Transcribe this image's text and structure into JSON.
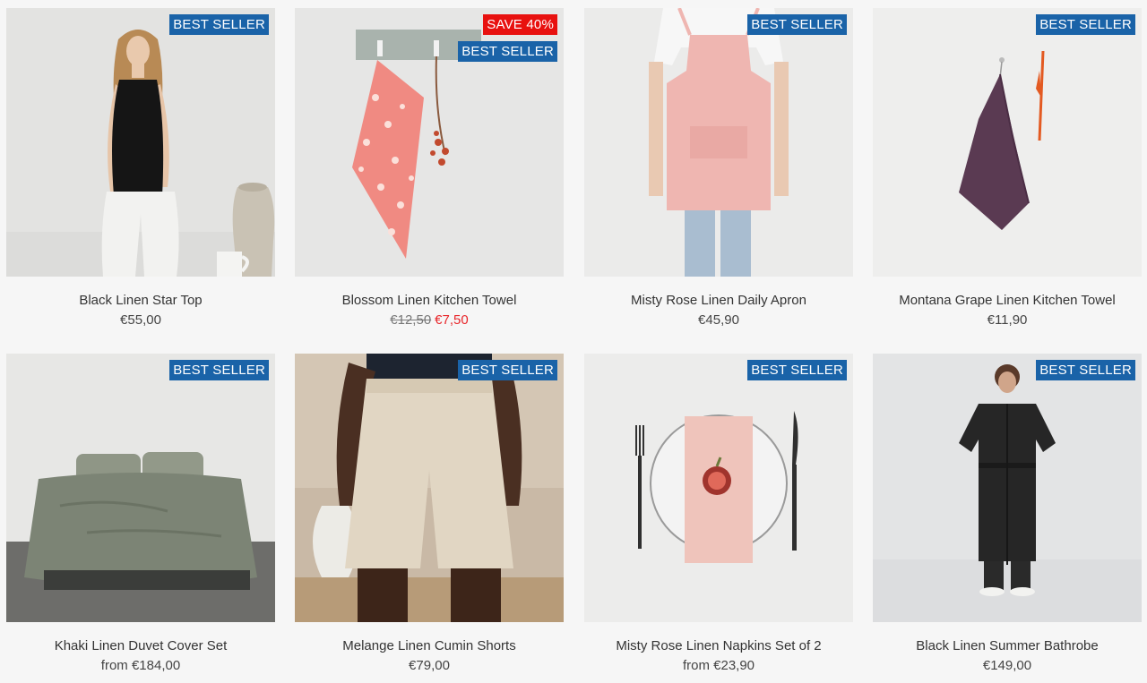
{
  "badges": {
    "best_seller": "BEST SELLER",
    "save": "SAVE 40%"
  },
  "products": [
    {
      "name": "Black Linen Star Top",
      "price": "€55,00"
    },
    {
      "name": "Blossom Linen Kitchen Towel",
      "old_price": "€12,50",
      "sale_price": "€7,50"
    },
    {
      "name": "Misty Rose Linen Daily Apron",
      "price": "€45,90"
    },
    {
      "name": "Montana Grape Linen Kitchen Towel",
      "price": "€11,90"
    },
    {
      "name": "Khaki Linen Duvet Cover Set",
      "price": "from €184,00"
    },
    {
      "name": "Melange Linen Cumin Shorts",
      "price": "€79,00"
    },
    {
      "name": "Misty Rose Linen Napkins Set of 2",
      "price": "from €23,90"
    },
    {
      "name": "Black Linen Summer Bathrobe",
      "price": "€149,00"
    }
  ],
  "colors": {
    "badge_blue": "#1a63a8",
    "badge_red": "#e8110f",
    "sale_price": "#e8262a",
    "page_background": "#f6f6f6"
  }
}
